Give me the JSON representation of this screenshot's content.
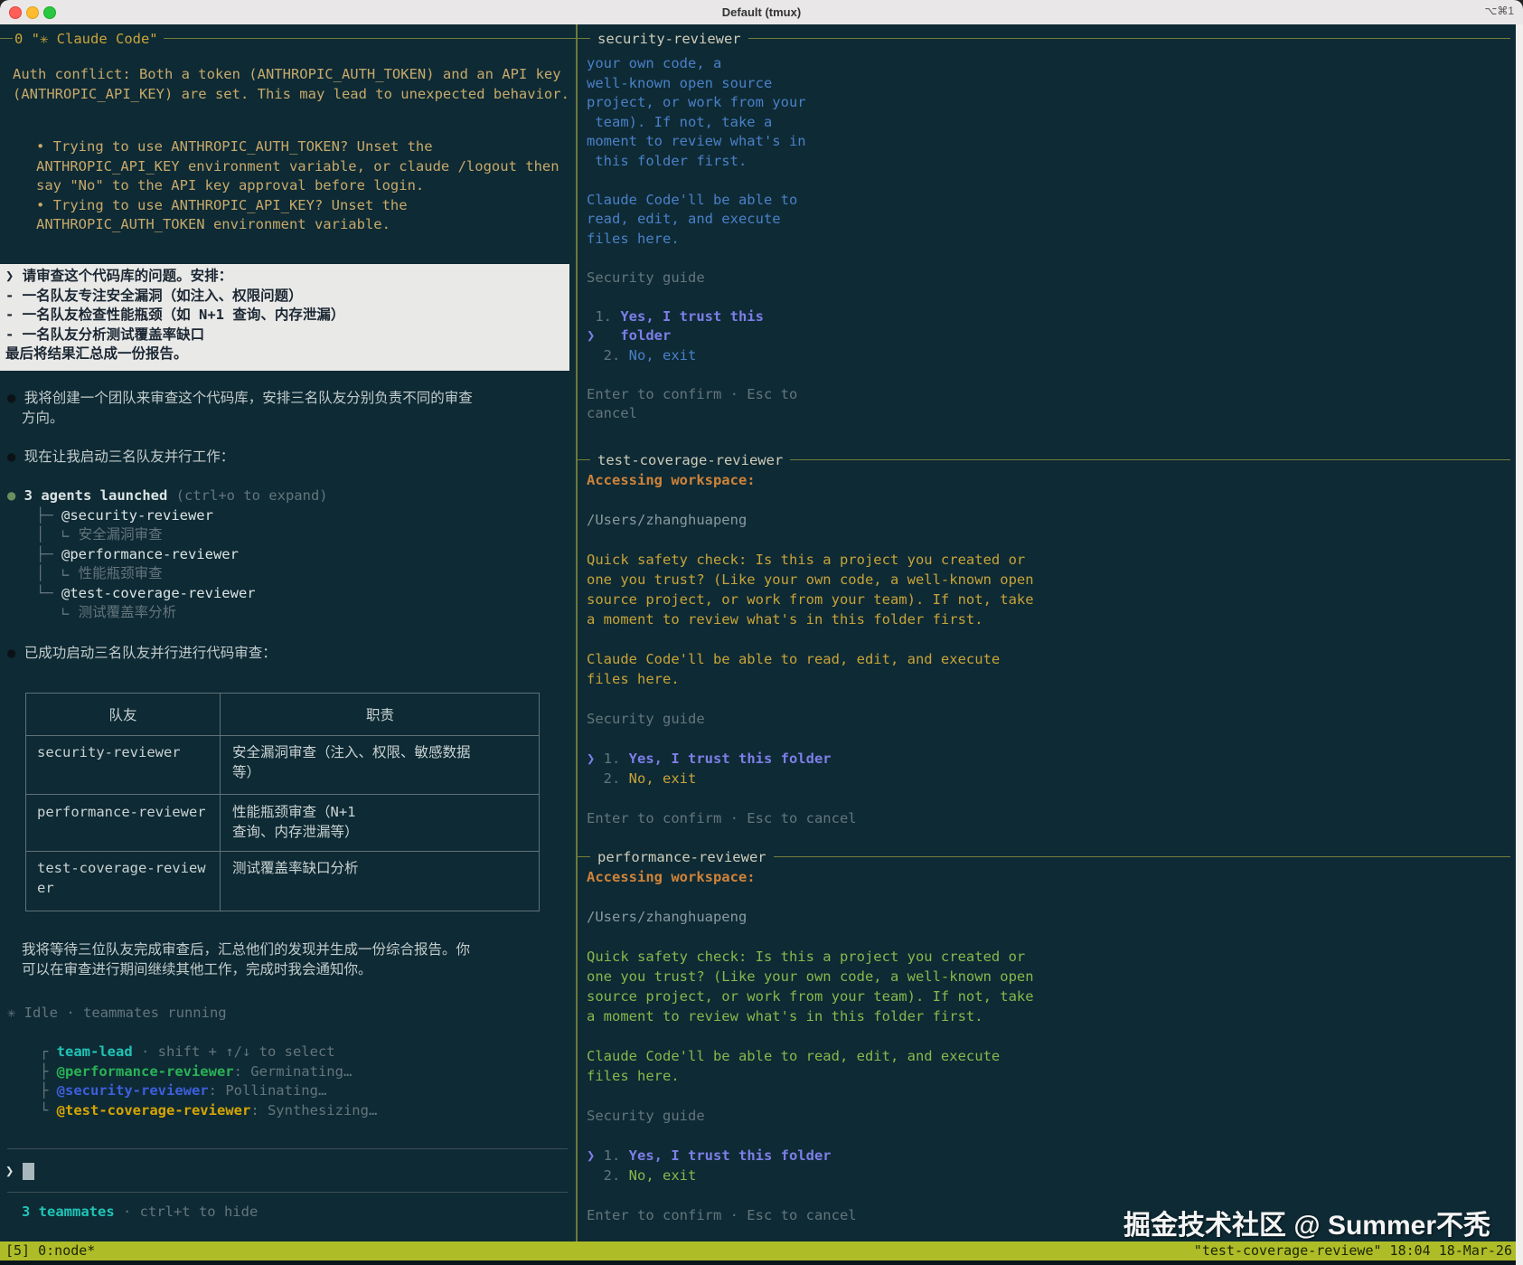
{
  "window": {
    "title": "Default (tmux)",
    "shortcut": "⌥⌘1"
  },
  "colors": {
    "background": "#0e2a34",
    "pane_border": "#6e7839",
    "left_pane_title": "#c9a43b",
    "right_pane_title": "#cfccba",
    "warning_text": "#c7a96b",
    "prompt_box_bg": "#e9e9e7",
    "prompt_box_text": "#1b2733",
    "response_text": "#c2cccc",
    "dim_text": "#64757c",
    "team_lead_cyan": "#1fc5b7",
    "performance_green": "#29b356",
    "security_blue": "#3d5fdd",
    "coverage_yellow": "#d7a502",
    "pane_body_blue": "#4a80c8",
    "pane_body_yellow": "#c7a339",
    "pane_body_green": "#86b84c",
    "selection_purple": "#7d7ee8",
    "accessing_orange": "#cf833a",
    "status_bar_bg": "#aebc28",
    "status_bar_text": "#1c2604"
  },
  "left_pane": {
    "title": "0 \"✳ Claude Code\"",
    "auth_warning": [
      "Auth conflict: Both a token (ANTHROPIC_AUTH_TOKEN) and an API key",
      "(ANTHROPIC_API_KEY) are set. This may lead to unexpected behavior."
    ],
    "auth_tips": [
      "• Trying to use ANTHROPIC_AUTH_TOKEN? Unset the",
      "ANTHROPIC_API_KEY environment variable, or claude /logout then",
      "say \"No\" to the API key approval before login.",
      "• Trying to use ANTHROPIC_API_KEY? Unset the",
      "ANTHROPIC_AUTH_TOKEN environment variable."
    ],
    "user_prompt": {
      "marker": "❯ ",
      "lines": [
        "请审查这个代码库的问题。安排：",
        "- 一名队友专注安全漏洞（如注入、权限问题）",
        "- 一名队友检查性能瓶颈（如 N+1 查询、内存泄漏）",
        "- 一名队友分析测试覆盖率缺口",
        "最后将结果汇总成一份报告。"
      ]
    },
    "bullet": "●",
    "response_1": [
      "我将创建一个团队来审查这个代码库，安排三名队友分别负责不同的审查",
      "方向。"
    ],
    "response_2": "现在让我启动三名队友并行工作：",
    "agents_launched": {
      "label": " 3 agents launched",
      "hint": " (ctrl+o to expand)",
      "agents": [
        {
          "branch": "├─ ",
          "name": "@security-reviewer",
          "task": "│  ∟ 安全漏洞审查"
        },
        {
          "branch": "├─ ",
          "name": "@performance-reviewer",
          "task": "│  ∟ 性能瓶颈审查"
        },
        {
          "branch": "└─ ",
          "name": "@test-coverage-reviewer",
          "task": "   ∟ 测试覆盖率分析"
        }
      ]
    },
    "response_3": "已成功启动三名队友并行进行代码审查：",
    "table": {
      "headers": [
        "队友",
        "职责"
      ],
      "rows": [
        {
          "name": [
            "security-reviewer",
            ""
          ],
          "duty": [
            "安全漏洞审查（注入、权限、敏感数据",
            "等）"
          ]
        },
        {
          "name": [
            "performance-reviewer",
            ""
          ],
          "duty": [
            "性能瓶颈审查（N+1",
            "查询、内存泄漏等）"
          ]
        },
        {
          "name": [
            "test-coverage-review",
            "er"
          ],
          "duty": [
            "测试覆盖率缺口分析",
            ""
          ]
        }
      ]
    },
    "closing": [
      "我将等待三位队友完成审查后，汇总他们的发现并生成一份综合报告。你",
      "可以在审查进行期间继续其他工作，完成时我会通知你。"
    ],
    "status": {
      "spinner": "✳ ",
      "text": "Idle · teammates running"
    },
    "team_panel": {
      "lead": {
        "branch": "┌ ",
        "name": "team-lead",
        "hint": " · shift + ↑/↓ to select"
      },
      "members": [
        {
          "branch": "├ ",
          "name": "@performance-reviewer",
          "status": ": Germinating…"
        },
        {
          "branch": "├ ",
          "name": "@security-reviewer",
          "status": ": Pollinating…"
        },
        {
          "branch": "└ ",
          "name": "@test-coverage-reviewer",
          "status": ": Synthesizing…"
        }
      ]
    },
    "input_prompt": "❯",
    "teammates_bar": {
      "count": "3 teammates",
      "hint": " · ctrl+t to hide"
    }
  },
  "right_panes": [
    {
      "title": "security-reviewer",
      "body": [
        "your own code, a",
        "well-known open source",
        "project, or work from your",
        " team). If not, take a",
        "moment to review what's in",
        " this folder first.",
        "",
        "Claude Code'll be able to",
        "read, edit, and execute",
        "files here."
      ],
      "guide": "Security guide",
      "opt1_num": " 1.",
      "opt1_text": " Yes, I trust this",
      "opt1b_marker": "❯",
      "opt1b_text": "   folder",
      "opt2_num": "  2.",
      "opt2_text": " No, exit",
      "footer_1": "Enter to confirm · Esc to",
      "footer_2": "cancel"
    },
    {
      "title": "test-coverage-reviewer",
      "accessing": "Accessing workspace:",
      "path": "/Users/zhanghuapeng",
      "body": [
        "Quick safety check: Is this a project you created or",
        "one you trust? (Like your own code, a well-known open",
        "source project, or work from your team). If not, take",
        "a moment to review what's in this folder first.",
        "",
        "Claude Code'll be able to read, edit, and execute",
        "files here."
      ],
      "guide": "Security guide",
      "opt_marker": "❯ ",
      "opt1_num": "1.",
      "opt1_text": " Yes, I trust this folder",
      "opt2_num": "  2.",
      "opt2_text": " No, exit",
      "footer": "Enter to confirm · Esc to cancel"
    },
    {
      "title": "performance-reviewer",
      "accessing": "Accessing workspace:",
      "path": "/Users/zhanghuapeng",
      "body": [
        "Quick safety check: Is this a project you created or",
        "one you trust? (Like your own code, a well-known open",
        "source project, or work from your team). If not, take",
        "a moment to review what's in this folder first.",
        "",
        "Claude Code'll be able to read, edit, and execute",
        "files here."
      ],
      "guide": "Security guide",
      "opt_marker": "❯ ",
      "opt1_num": "1.",
      "opt1_text": " Yes, I trust this folder",
      "opt2_num": "  2.",
      "opt2_text": " No, exit",
      "footer": "Enter to confirm · Esc to cancel"
    }
  ],
  "status_bar": {
    "left": "[5] 0:node*",
    "right": "\"test-coverage-reviewe\" 18:04 18-Mar-26"
  },
  "watermark": "掘金技术社区 @ Summer不秃"
}
